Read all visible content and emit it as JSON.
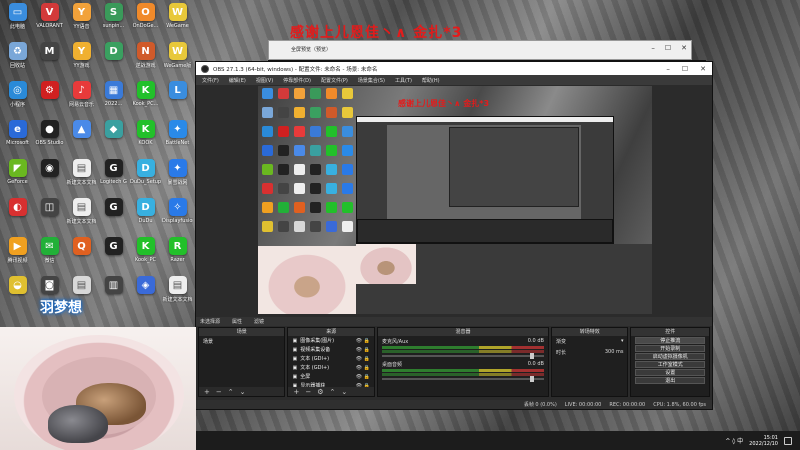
{
  "desktop": {
    "icons": [
      {
        "label": "此电脑",
        "color": "#3a8dde",
        "glyph": "▭"
      },
      {
        "label": "VALORANT",
        "color": "#d33a3a",
        "glyph": "V"
      },
      {
        "label": "YY语音",
        "color": "#f2a23a",
        "glyph": "Y"
      },
      {
        "label": "sunpin...",
        "color": "#3a9a5a",
        "glyph": "S"
      },
      {
        "label": "OnDoGe...",
        "color": "#f08a2a",
        "glyph": "O"
      },
      {
        "label": "WeGame",
        "color": "#e8c83a",
        "glyph": "W"
      },
      {
        "label": "回收站",
        "color": "#7aa7d8",
        "glyph": "♻"
      },
      {
        "label": "",
        "color": "#444",
        "glyph": "M"
      },
      {
        "label": "YY游戏",
        "color": "#f0b030",
        "glyph": "Y"
      },
      {
        "label": "",
        "color": "#3aa060",
        "glyph": "D"
      },
      {
        "label": "逆战游戏",
        "color": "#d05a2a",
        "glyph": "N"
      },
      {
        "label": "WeGame版",
        "color": "#e8c83a",
        "glyph": "W"
      },
      {
        "label": "小程序",
        "color": "#2a8ad8",
        "glyph": "◎"
      },
      {
        "label": "",
        "color": "#d02020",
        "glyph": "⚙"
      },
      {
        "label": "网易云音乐",
        "color": "#e83a3a",
        "glyph": "♪"
      },
      {
        "label": "2022...",
        "color": "#3a7ad8",
        "glyph": "▦"
      },
      {
        "label": "Kook_PC...",
        "color": "#22c02a",
        "glyph": "K"
      },
      {
        "label": "",
        "color": "#3a8dde",
        "glyph": "L"
      },
      {
        "label": "Microsoft",
        "color": "#2a6ad8",
        "glyph": "e"
      },
      {
        "label": "OBS Studio",
        "color": "#222",
        "glyph": "●"
      },
      {
        "label": "",
        "color": "#4a8ae8",
        "glyph": "▲"
      },
      {
        "label": "",
        "color": "#3aa0a0",
        "glyph": "◆"
      },
      {
        "label": "KOOK",
        "color": "#22c02a",
        "glyph": "K"
      },
      {
        "label": "BattleNet",
        "color": "#2a8ae8",
        "glyph": "✦"
      },
      {
        "label": "GeForce",
        "color": "#6ab820",
        "glyph": "◤"
      },
      {
        "label": "",
        "color": "#222",
        "glyph": "◉"
      },
      {
        "label": "新建文本文档",
        "color": "#eee",
        "glyph": "▤"
      },
      {
        "label": "Logitech G",
        "color": "#222",
        "glyph": "G"
      },
      {
        "label": "DuDu_Setup",
        "color": "#38b0e0",
        "glyph": "D"
      },
      {
        "label": "暴雪战网",
        "color": "#2a7ae8",
        "glyph": "✦"
      },
      {
        "label": "",
        "color": "#d83030",
        "glyph": "◐"
      },
      {
        "label": "",
        "color": "#444",
        "glyph": "◫"
      },
      {
        "label": "新建文本文档",
        "color": "#eee",
        "glyph": "▤"
      },
      {
        "label": "",
        "color": "#222",
        "glyph": "G"
      },
      {
        "label": "DuDu",
        "color": "#38b0e0",
        "glyph": "D"
      },
      {
        "label": "Displayfusion",
        "color": "#2a7ae8",
        "glyph": "✧"
      },
      {
        "label": "腾讯视频",
        "color": "#f0a020",
        "glyph": "▶"
      },
      {
        "label": "微信",
        "color": "#22b038",
        "glyph": "✉"
      },
      {
        "label": "",
        "color": "#e06020",
        "glyph": "Q"
      },
      {
        "label": "",
        "color": "#222",
        "glyph": "G"
      },
      {
        "label": "Kook_PC",
        "color": "#22c02a",
        "glyph": "K"
      },
      {
        "label": "Razer",
        "color": "#22c02a",
        "glyph": "R"
      },
      {
        "label": "",
        "color": "#e0c030",
        "glyph": "◒"
      },
      {
        "label": "",
        "color": "#444",
        "glyph": "◙"
      },
      {
        "label": "",
        "color": "#d8d8d8",
        "glyph": "▤"
      },
      {
        "label": "",
        "color": "#444",
        "glyph": "▥"
      },
      {
        "label": "",
        "color": "#3a6ad8",
        "glyph": "◈"
      },
      {
        "label": "新建文本文档",
        "color": "#eee",
        "glyph": "▤"
      }
    ]
  },
  "overlay_text": {
    "red_caption": "感谢上儿恩佳丶∧ 金扎*3",
    "logo_text": "羽梦想"
  },
  "projector_window": {
    "title": "全屏预览（预览）"
  },
  "obs": {
    "title": "OBS 27.1.3 (64-bit, windows) - 配置文件: 未命名 - 场景: 未命名",
    "menu": [
      "文件(F)",
      "编辑(E)",
      "视图(V)",
      "停靠部件(D)",
      "配置文件(P)",
      "场景集合(S)",
      "工具(T)",
      "帮助(H)"
    ],
    "scene_bar": {
      "label": "未选择源",
      "props": "属性",
      "filters": "滤镜"
    },
    "docks": {
      "scenes": {
        "title": "场景",
        "items": [
          "场景"
        ]
      },
      "sources": {
        "title": "来源",
        "items": [
          {
            "label": "图像采集(图片)"
          },
          {
            "label": "视频采集设备"
          },
          {
            "label": "文本 (GDI+)"
          },
          {
            "label": "文本 (GDI+)"
          },
          {
            "label": "全屏"
          },
          {
            "label": "显示器捕获"
          }
        ]
      },
      "mixer": {
        "title": "混音器",
        "channels": [
          {
            "name": "麦克风/Aux",
            "db": "0.0 dB"
          },
          {
            "name": "桌面音频",
            "db": "0.0 dB"
          }
        ]
      },
      "transitions": {
        "title": "转场特效",
        "type_label": "渐变",
        "duration_label": "时长",
        "duration_value": "300 ms"
      },
      "controls": {
        "title": "控件",
        "buttons": [
          "停止推流",
          "开始录制",
          "启动虚拟摄像机",
          "工作室模式",
          "设置",
          "退出"
        ]
      }
    },
    "status": {
      "dropped": "丢帧 0 (0.0%)",
      "live": "LIVE: 00:00:00",
      "rec": "REC: 00:00:00",
      "cpu": "CPU: 1.8%, 60.00 fps"
    }
  },
  "taskbar": {
    "tray": "^ ◊ 中",
    "time": "15:01",
    "date": "2022/12/10"
  }
}
